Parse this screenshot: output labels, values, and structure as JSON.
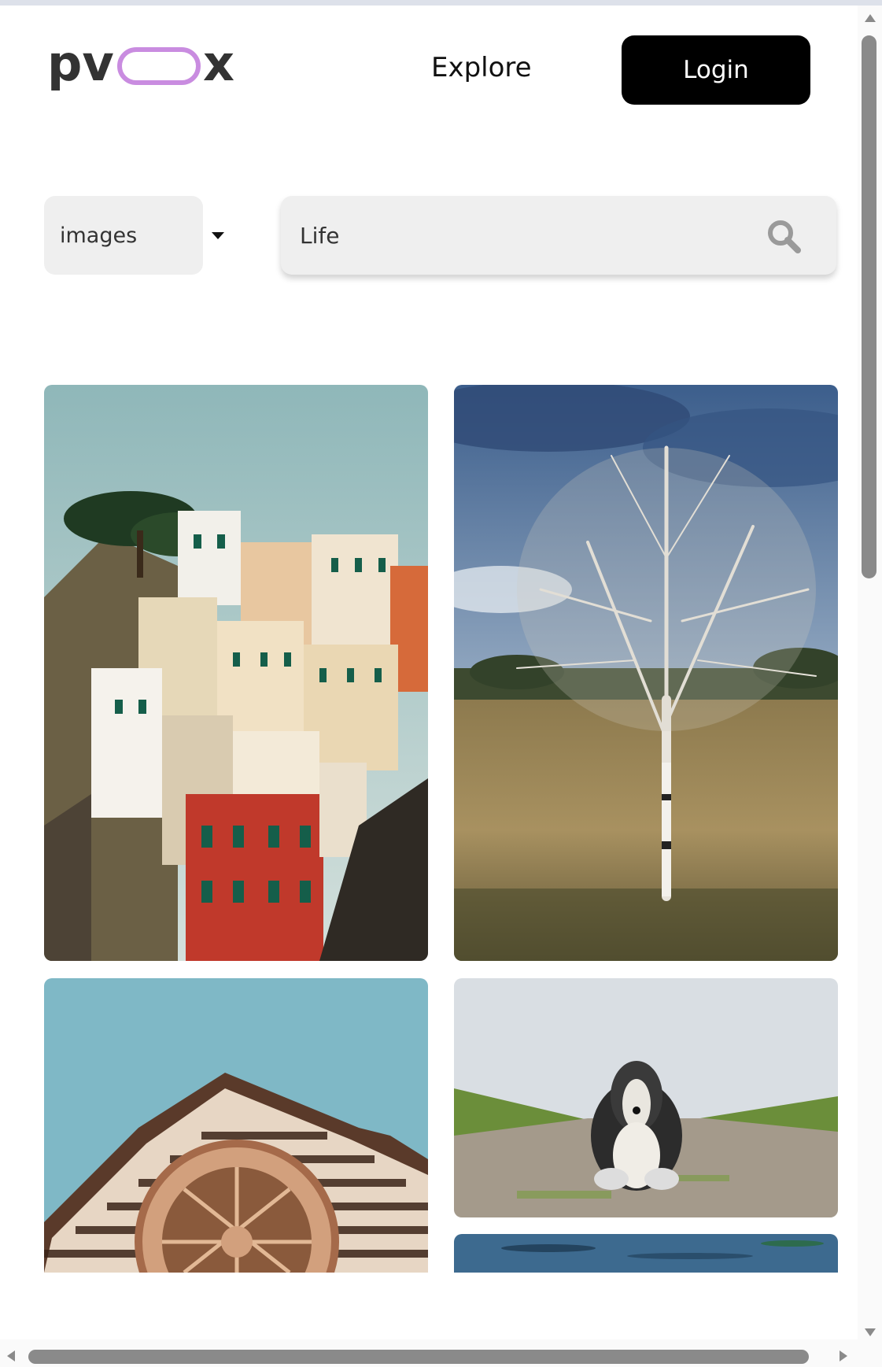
{
  "brand": {
    "logo_text_left": "pv",
    "logo_text_right": "x",
    "accent": "#c98ce0"
  },
  "nav": {
    "explore_label": "Explore",
    "login_label": "Login"
  },
  "search": {
    "type_selected": "images",
    "query": "Life",
    "icon": "search-icon"
  },
  "results": [
    {
      "subject": "cliffside-village-photo"
    },
    {
      "subject": "birch-tree-field-photo"
    },
    {
      "subject": "church-rose-window-photo"
    },
    {
      "subject": "sheepdog-on-path-photo"
    },
    {
      "subject": "water-surface-photo"
    }
  ],
  "colors": {
    "login_bg": "#000000",
    "input_bg": "#efefef"
  }
}
